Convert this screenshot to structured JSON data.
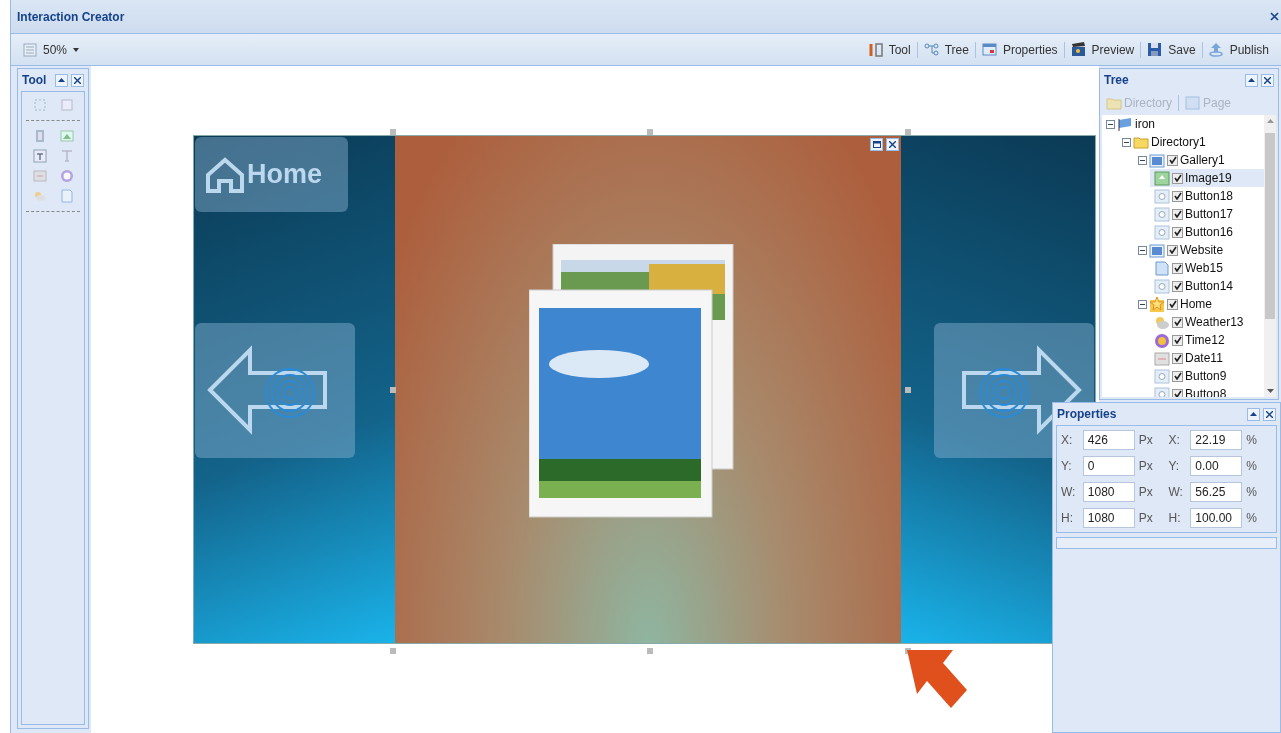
{
  "window": {
    "title": "Interaction Creator"
  },
  "toolbar": {
    "zoom": "50%",
    "buttons": [
      {
        "kind": "tool",
        "label": "Tool"
      },
      {
        "kind": "tree",
        "label": "Tree"
      },
      {
        "kind": "properties",
        "label": "Properties"
      },
      {
        "kind": "preview",
        "label": "Preview"
      },
      {
        "kind": "save",
        "label": "Save"
      },
      {
        "kind": "publish",
        "label": "Publish"
      }
    ]
  },
  "tool_panel": {
    "title": "Tool"
  },
  "canvas": {
    "home_button": "Home"
  },
  "tree_panel": {
    "title": "Tree",
    "buttons": [
      {
        "kind": "folder",
        "label": "Directory",
        "disabled": true
      },
      {
        "kind": "page",
        "label": "Page",
        "disabled": true
      }
    ],
    "nodes": [
      {
        "kind": "root",
        "label": "iron",
        "expanded": true,
        "children": [
          {
            "kind": "folder",
            "label": "Directory1",
            "expanded": true,
            "children": [
              {
                "kind": "gallery",
                "label": "Gallery1",
                "checked": true,
                "expanded": true,
                "children": [
                  {
                    "kind": "image",
                    "label": "Image19",
                    "checked": true,
                    "selected": true
                  },
                  {
                    "kind": "button",
                    "label": "Button18",
                    "checked": true,
                    "selected": false
                  },
                  {
                    "kind": "button",
                    "label": "Button17",
                    "checked": true,
                    "selected": false
                  },
                  {
                    "kind": "button",
                    "label": "Button16",
                    "checked": true,
                    "selected": false
                  }
                ]
              },
              {
                "kind": "gallery",
                "label": "Website",
                "checked": true,
                "expanded": true,
                "children": [
                  {
                    "kind": "web",
                    "label": "Web15",
                    "checked": true,
                    "selected": false
                  },
                  {
                    "kind": "button",
                    "label": "Button14",
                    "checked": true,
                    "selected": false
                  }
                ]
              },
              {
                "kind": "home",
                "label": "Home",
                "checked": true,
                "expanded": true,
                "children": [
                  {
                    "kind": "weather",
                    "label": "Weather13",
                    "checked": true,
                    "selected": false
                  },
                  {
                    "kind": "time",
                    "label": "Time12",
                    "checked": true,
                    "selected": false
                  },
                  {
                    "kind": "date",
                    "label": "Date11",
                    "checked": true,
                    "selected": false
                  },
                  {
                    "kind": "button",
                    "label": "Button9",
                    "checked": true,
                    "selected": false
                  },
                  {
                    "kind": "button",
                    "label": "Button8",
                    "checked": true,
                    "selected": false
                  }
                ]
              }
            ]
          }
        ]
      }
    ]
  },
  "properties_panel": {
    "title": "Properties",
    "rows": [
      {
        "label": "X:",
        "px": "426",
        "px_unit": "Px",
        "pct_label": "X:",
        "pct": "22.19",
        "pct_unit": "%"
      },
      {
        "label": "Y:",
        "px": "0",
        "px_unit": "Px",
        "pct_label": "Y:",
        "pct": "0.00",
        "pct_unit": "%"
      },
      {
        "label": "W:",
        "px": "1080",
        "px_unit": "Px",
        "pct_label": "W:",
        "pct": "56.25",
        "pct_unit": "%"
      },
      {
        "label": "H:",
        "px": "1080",
        "px_unit": "Px",
        "pct_label": "H:",
        "pct": "100.00",
        "pct_unit": "%"
      }
    ]
  }
}
